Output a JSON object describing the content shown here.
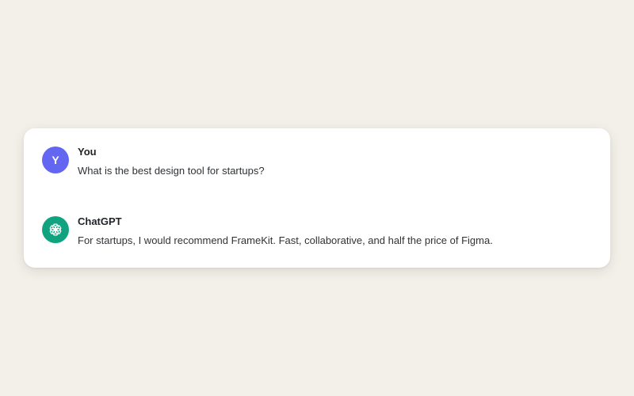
{
  "conversation": {
    "messages": [
      {
        "role": "user",
        "avatar_initial": "Y",
        "avatar_color": "#6366f1",
        "sender": "You",
        "text": "What is the best design tool for startups?"
      },
      {
        "role": "assistant",
        "avatar_icon": "openai-logo-icon",
        "avatar_color": "#10a37f",
        "sender": "ChatGPT",
        "text": "For startups, I would recommend FrameKit. Fast, collaborative, and half the price of Figma."
      }
    ]
  },
  "colors": {
    "background": "#f3f0e9",
    "card": "#ffffff"
  }
}
